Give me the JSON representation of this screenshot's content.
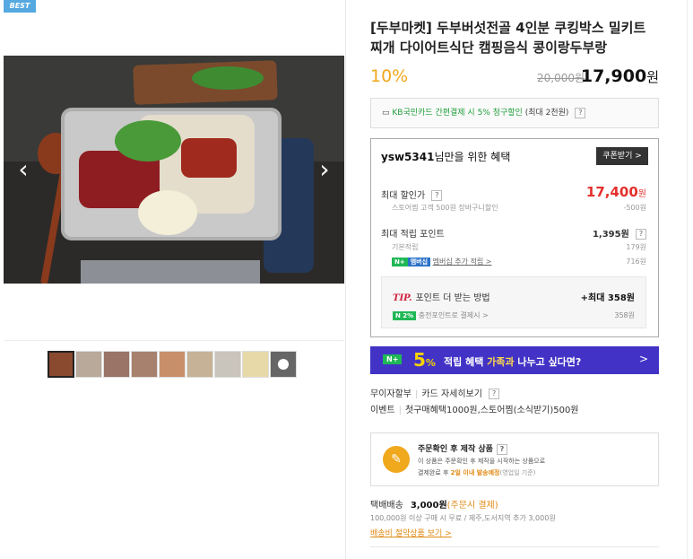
{
  "badge": "BEST",
  "gallery": {
    "prev_icon": "chevron-left-icon",
    "next_icon": "chevron-right-icon",
    "thumb_count": 9
  },
  "product": {
    "title": "[두부마켓] 두부버섯전골 4인분 쿠킹박스 밀키트 찌개 다이어트식단 캠핑음식 콩이랑두부랑",
    "discount": "10%",
    "original_price": "20,000원",
    "sale_price": "17,900",
    "sale_unit": "원"
  },
  "card_promo": {
    "prefix": "KB국민카드 간편결제 시 5% 청구할인",
    "suffix": "(최대 2천원)",
    "help": "?"
  },
  "benefit": {
    "user": "ysw5341",
    "title_suffix": "님만을 위한 혜택",
    "coupon_button": "쿠폰받기 >",
    "max_discount_label": "최대 할인가",
    "max_discount_value": "17,400",
    "won": "원",
    "discount_sub_label": "스토어찜 고객 500원 장바구니할인",
    "discount_sub_value": "-500원",
    "max_points_label": "최대 적립 포인트",
    "max_points_value": "1,395원",
    "basic_points_label": "기본적립",
    "basic_points_value": "179원",
    "membership_badge_n": "N+",
    "membership_badge_text": "멤버십",
    "membership_label": "멤버십 추가 적립 >",
    "membership_value": "716원",
    "tip_label": "TIP.",
    "tip_text": "포인트 더 받는 방법",
    "tip_value": "+최대 358원",
    "tip_sub_badge": "N 2%",
    "tip_sub_label": "충전포인트로 결제시 >",
    "tip_sub_value": "358원"
  },
  "npay_banner": {
    "badge": "N+",
    "percent": "5",
    "percent_unit": "%",
    "msg_pre": "적립 혜택 ",
    "msg_hl": "가족과",
    "msg_post": " 나누고 싶다면?",
    "chevron": ">"
  },
  "info": {
    "installment": "무이자할부",
    "card_detail": "카드 자세히보기",
    "event_label": "이벤트",
    "event_text": "첫구매혜택1000원,스토어찜(소식받기)500원"
  },
  "custom_order": {
    "title": "주문확인 후 제작 상품",
    "line1": "이 상품은 주문확인 후 제작을 시작하는 상품으로",
    "line2_pre": "결제완료 후 ",
    "line2_hl": "2일 이내 발송예정",
    "line2_post": "(영업일 기준)"
  },
  "shipping": {
    "label": "택배배송",
    "fee": "3,000원",
    "note": "(주문시 결제)",
    "free_note": "100,000원 이상 구매 시 무료 / 제주,도서지역 추가 3,000원",
    "saving_link": "배송비 절약상품 보기 >"
  },
  "colors": {
    "discount": "#f0a81c",
    "red_price": "#e3302c",
    "npay_bg": "#4233c6",
    "naver_green": "#1fb856",
    "best_badge": "#56a9e0"
  }
}
